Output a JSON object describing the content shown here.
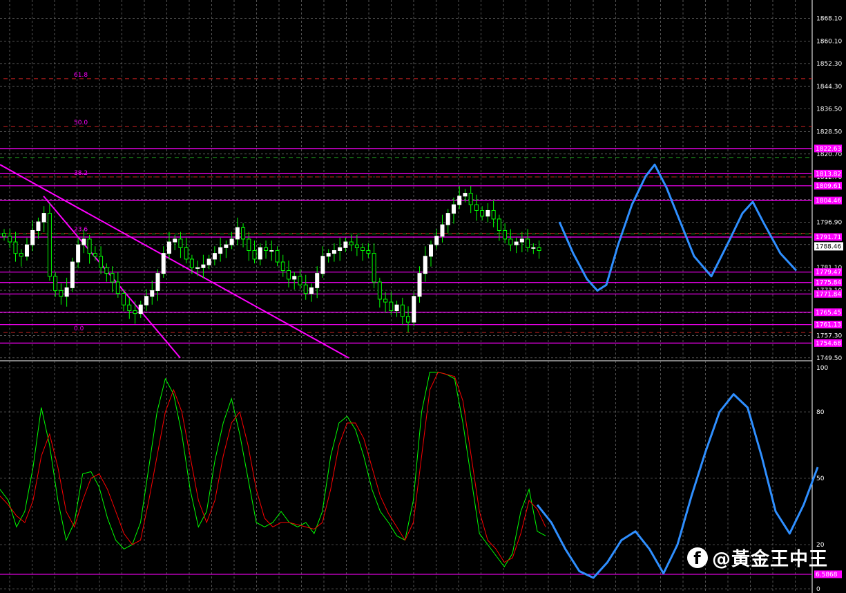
{
  "chart_data": [
    {
      "type": "candlestick",
      "title": "",
      "ylim": [
        1748.5,
        1874.0
      ],
      "yticks": [
        "1868.10",
        "1860.10",
        "1852.30",
        "1844.30",
        "1836.50",
        "1828.50",
        "1820.70",
        "1812.70",
        "1804.90",
        "1796.90",
        "1789.10",
        "1781.10",
        "1773.10",
        "1765.30",
        "1757.30",
        "1749.50"
      ],
      "last_price": "1788.46",
      "colors": {
        "bull": "#ffffff",
        "bear": "#00ff00",
        "wick": "#00ff00"
      },
      "horizontal_levels": [
        {
          "label": "1822.63",
          "value": 1822.63
        },
        {
          "label": "1813.82",
          "value": 1813.82
        },
        {
          "label": "1809.61",
          "value": 1809.61
        },
        {
          "label": "1804.46",
          "value": 1804.46
        },
        {
          "label": "1791.71",
          "value": 1791.71
        },
        {
          "label": "1779.47",
          "value": 1779.47
        },
        {
          "label": "1775.84",
          "value": 1775.84
        },
        {
          "label": "1771.84",
          "value": 1771.84
        },
        {
          "label": "1765.45",
          "value": 1765.45
        },
        {
          "label": "1761.13",
          "value": 1761.13
        },
        {
          "label": "1754.68",
          "value": 1754.68
        }
      ],
      "fibonacci": [
        {
          "label": "61.8",
          "value": 1847.0
        },
        {
          "label": "50.0",
          "value": 1830.3
        },
        {
          "label": "38.2",
          "value": 1812.7
        },
        {
          "label": "23.6",
          "value": 1793.0
        },
        {
          "label": "0.0",
          "value": 1758.4
        }
      ],
      "level_color": "#ff00ff",
      "projection_color": "#2f8fff",
      "closes": [
        1792,
        1790,
        1786,
        1785,
        1789,
        1794,
        1797,
        1800,
        1778,
        1773,
        1771,
        1774,
        1783,
        1789,
        1791,
        1786,
        1785,
        1781,
        1779,
        1776,
        1772,
        1768,
        1766,
        1765,
        1768,
        1771,
        1773,
        1779,
        1786,
        1790,
        1791,
        1788,
        1784,
        1781,
        1781,
        1782,
        1784,
        1786,
        1788,
        1789,
        1791,
        1795,
        1791,
        1787,
        1784,
        1788,
        1787,
        1787,
        1783,
        1780,
        1777,
        1778,
        1775,
        1772,
        1774,
        1779,
        1785,
        1786,
        1787,
        1788,
        1790,
        1789,
        1788,
        1787,
        1786,
        1776,
        1770,
        1769,
        1766,
        1768,
        1764,
        1762,
        1771,
        1779,
        1785,
        1789,
        1792,
        1796,
        1800,
        1803,
        1806,
        1807,
        1803,
        1801,
        1799,
        1801,
        1798,
        1794,
        1791,
        1789,
        1790,
        1791,
        1788,
        1788,
        1787
      ]
    },
    {
      "type": "line",
      "title": "",
      "ylim": [
        0,
        100
      ],
      "yticks": [
        "100",
        "80",
        "50",
        "20",
        "0"
      ],
      "level_label": "6.5868",
      "level_value": 6.5868,
      "series": [
        {
          "color": "#00ff00",
          "values": [
            45,
            40,
            28,
            35,
            55,
            82,
            65,
            40,
            22,
            30,
            52,
            53,
            46,
            32,
            22,
            18,
            20,
            30,
            55,
            80,
            95,
            88,
            70,
            45,
            28,
            35,
            58,
            75,
            86,
            70,
            50,
            30,
            28,
            30,
            35,
            30,
            28,
            30,
            25,
            35,
            60,
            75,
            78,
            72,
            60,
            45,
            35,
            30,
            24,
            22,
            40,
            80,
            98,
            98,
            97,
            95,
            75,
            50,
            25,
            20,
            15,
            10,
            16,
            35,
            45,
            26,
            24
          ]
        },
        {
          "color": "#ff0000",
          "values": [
            42,
            38,
            33,
            30,
            40,
            60,
            70,
            55,
            35,
            28,
            40,
            50,
            52,
            45,
            35,
            25,
            20,
            22,
            40,
            60,
            80,
            90,
            80,
            60,
            40,
            30,
            40,
            60,
            75,
            80,
            65,
            45,
            32,
            28,
            30,
            30,
            29,
            28,
            27,
            30,
            45,
            65,
            75,
            75,
            68,
            55,
            42,
            34,
            28,
            22,
            30,
            60,
            90,
            98,
            97,
            96,
            85,
            60,
            35,
            22,
            18,
            12,
            14,
            25,
            40,
            36,
            28
          ]
        }
      ],
      "projection": [
        38,
        30,
        18,
        8,
        5,
        12,
        22,
        26,
        18,
        7,
        20,
        42,
        62,
        80,
        88,
        82,
        60,
        35,
        25,
        38,
        55
      ]
    }
  ],
  "watermark": {
    "icon_glyph": "f",
    "text": "@黃金王中王"
  }
}
